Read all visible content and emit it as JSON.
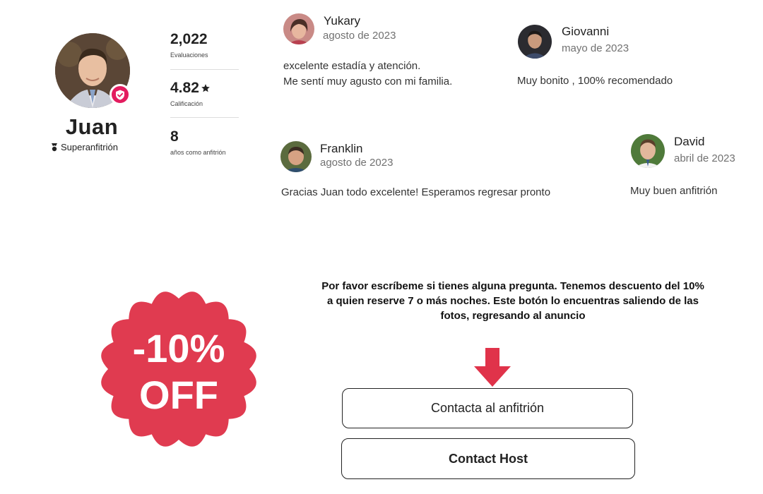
{
  "host": {
    "name": "Juan",
    "superhost_label": "Superanfitrión",
    "stats": [
      {
        "value": "2,022",
        "label": "Evaluaciones"
      },
      {
        "value": "4.82",
        "label": "Calificación",
        "icon": "star-icon"
      },
      {
        "value": "8",
        "label": "años como anfitrión"
      }
    ]
  },
  "reviews": [
    {
      "name": "Yukary",
      "date": "agosto de 2023",
      "text": "excelente estadía y atención.\nMe sentí muy agusto con mi familia."
    },
    {
      "name": "Giovanni",
      "date": "mayo de 2023",
      "text": "Muy bonito , 100% recomendado"
    },
    {
      "name": "Franklin",
      "date": "agosto de 2023",
      "text": "Gracias Juan todo excelente! Esperamos regresar pronto"
    },
    {
      "name": "David",
      "date": "abril de 2023",
      "text": "Muy buen anfitrión"
    }
  ],
  "promo": {
    "discount": "-10%",
    "off": "OFF",
    "message": "Por favor escríbeme si tienes alguna pregunta. Tenemos descuento del 10% a quien reserve 7 o más noches. Este botón lo encuentras saliendo de las fotos, regresando al anuncio"
  },
  "buttons": {
    "contact_es": "Contacta al anfitrión",
    "contact_en": "Contact Host"
  },
  "colors": {
    "accent": "#e31c5f",
    "promo_red": "#e03b50",
    "arrow_red": "#e0334a"
  }
}
